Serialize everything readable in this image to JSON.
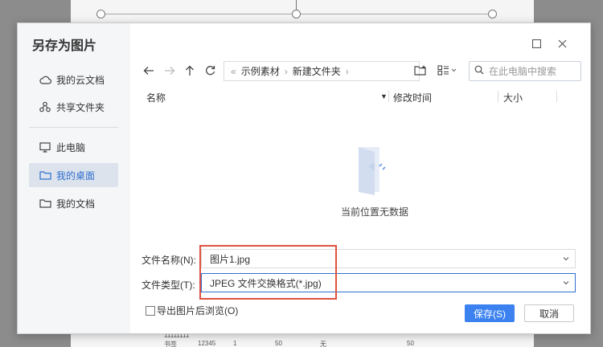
{
  "background": {
    "table_row_1": [
      "11111111",
      "",
      "",
      "",
      "",
      ""
    ],
    "table_row_2": [
      "书签",
      "12345",
      "1",
      "50",
      "无",
      "50"
    ]
  },
  "dialog": {
    "title": "另存为图片",
    "maximize_icon": "square-icon",
    "close_icon": "close-icon"
  },
  "sidebar": {
    "items": [
      {
        "label": "我的云文档",
        "icon": "cloud-icon"
      },
      {
        "label": "共享文件夹",
        "icon": "share-icon"
      },
      {
        "label": "此电脑",
        "icon": "monitor-icon"
      },
      {
        "label": "我的桌面",
        "icon": "folder-icon",
        "active": true
      },
      {
        "label": "我的文档",
        "icon": "folder-icon"
      }
    ]
  },
  "toolbar": {
    "breadcrumb": [
      "示例素材",
      "新建文件夹"
    ],
    "search_placeholder": "在此电脑中搜索"
  },
  "columns": {
    "name": "名称",
    "modified": "修改时间",
    "size": "大小"
  },
  "empty_state": {
    "text": "当前位置无数据"
  },
  "form": {
    "filename_label": "文件名称(N):",
    "filename_value": "图片1.jpg",
    "filetype_label": "文件类型(T):",
    "filetype_value": "JPEG 文件交换格式(*.jpg)",
    "export_label": "导出图片后浏览(O)"
  },
  "buttons": {
    "save": "保存(S)",
    "cancel": "取消"
  },
  "colors": {
    "accent": "#3b82f0",
    "highlight": "#e0513f",
    "sidebar_bg": "#f4f6f8"
  }
}
